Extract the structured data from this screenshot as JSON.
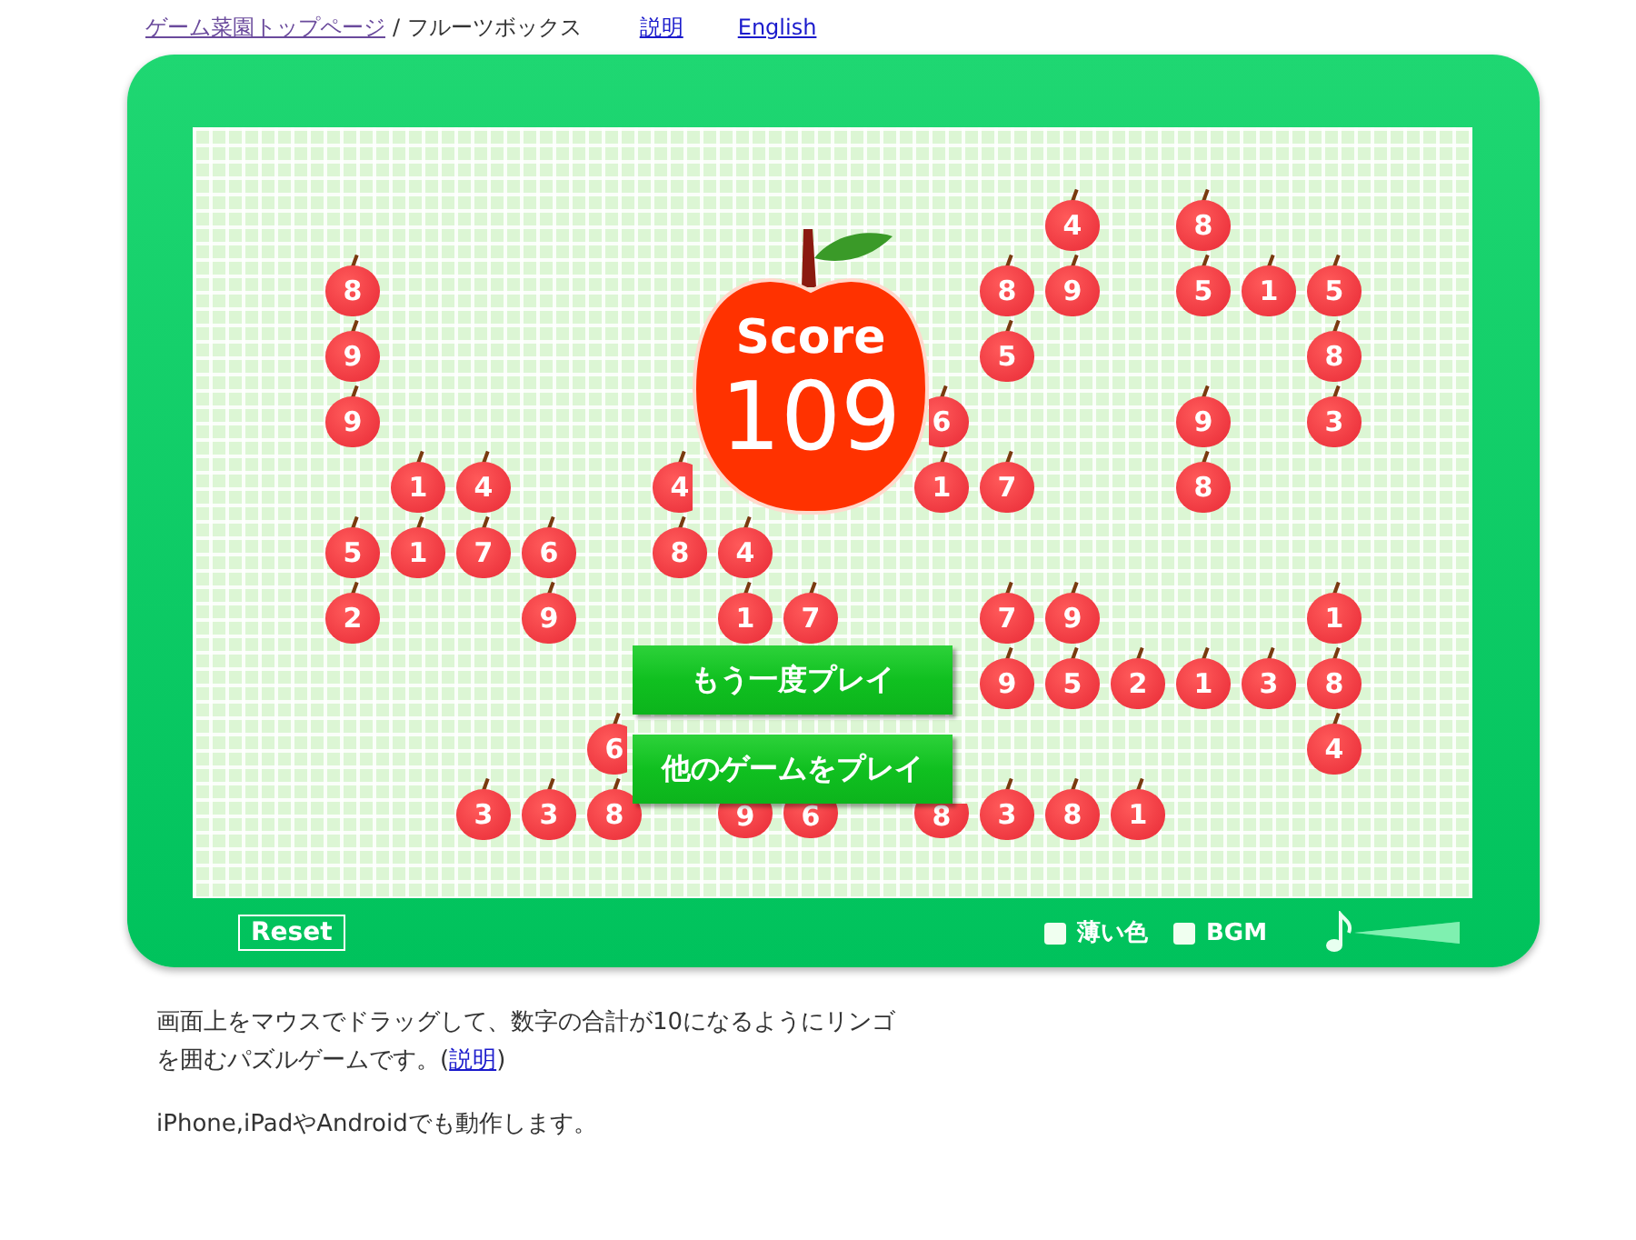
{
  "header": {
    "breadcrumb_link": "ゲーム菜園トップページ",
    "current_page": "/ フルーツボックス",
    "links": [
      "説明",
      "English"
    ]
  },
  "board": {
    "rows": [
      [
        null,
        null,
        null,
        null,
        null,
        null,
        null,
        null,
        null,
        null,
        null,
        "4",
        null,
        "8",
        null,
        null
      ],
      [
        "8",
        null,
        null,
        null,
        null,
        null,
        null,
        null,
        null,
        null,
        "8",
        "9",
        null,
        "5",
        "1",
        "5"
      ],
      [
        "9",
        null,
        null,
        null,
        null,
        null,
        null,
        null,
        null,
        null,
        "5",
        null,
        null,
        null,
        null,
        "8"
      ],
      [
        "9",
        null,
        null,
        null,
        null,
        null,
        null,
        null,
        null,
        {
          "value": "6",
          "kind": "leftclipped"
        },
        null,
        null,
        null,
        "9",
        null,
        "3"
      ],
      [
        null,
        "1",
        "4",
        null,
        null,
        {
          "value": "4",
          "kind": "rightclipped"
        },
        null,
        null,
        null,
        "1",
        "7",
        null,
        null,
        "8",
        null,
        null
      ],
      [
        "5",
        "1",
        "7",
        "6",
        null,
        "8",
        "4",
        null,
        null,
        null,
        null,
        null,
        null,
        null,
        null,
        null
      ],
      [
        "2",
        null,
        null,
        "9",
        null,
        null,
        "1",
        "7",
        null,
        null,
        "7",
        "9",
        null,
        null,
        null,
        "1"
      ],
      [
        null,
        null,
        null,
        null,
        null,
        null,
        null,
        null,
        null,
        null,
        "9",
        "5",
        "2",
        "1",
        "3",
        "8"
      ],
      [
        null,
        null,
        null,
        null,
        {
          "value": "6",
          "kind": "rightclipped"
        },
        null,
        null,
        null,
        null,
        null,
        null,
        null,
        null,
        null,
        null,
        "4"
      ],
      [
        null,
        null,
        "3",
        "3",
        "8",
        null,
        {
          "value": "9",
          "kind": "topclipped"
        },
        {
          "value": "6",
          "kind": "topclipped"
        },
        null,
        {
          "value": "8",
          "kind": "topclipped"
        },
        "3",
        "8",
        "1",
        null,
        null,
        null
      ]
    ],
    "score": {
      "label": "Score",
      "value": "109"
    },
    "buttons": [
      "もう一度プレイ",
      "他のゲームをプレイ"
    ]
  },
  "controls": {
    "reset": "Reset",
    "options": [
      {
        "label": "薄い色",
        "checked": false
      },
      {
        "label": "BGM",
        "checked": false
      }
    ],
    "volume": {
      "level": 1
    }
  },
  "description": {
    "intro": "画面上をマウスでドラッグして、数字の合計が10になるようにリンゴを囲むパズルゲームです。(",
    "link": "説明",
    "outro": ")",
    "note": "iPhone,iPadやAndroidでも動作します。"
  }
}
